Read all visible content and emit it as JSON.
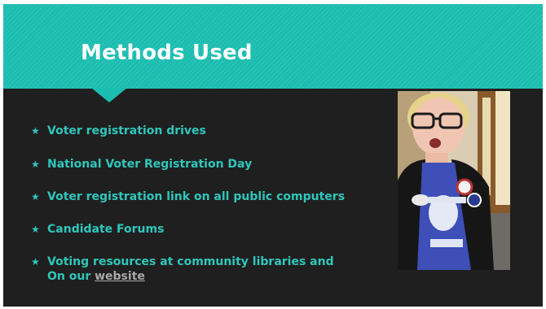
{
  "slide": {
    "title": "Methods Used",
    "bullets": [
      {
        "text": "Voter registration drives"
      },
      {
        "text": "National Voter Registration Day"
      },
      {
        "text": "Voter registration link on all public computers"
      },
      {
        "text": "Candidate Forums"
      },
      {
        "line1": "Voting resources at community libraries and",
        "line2_prefix": "On our ",
        "link_text": "website"
      }
    ],
    "bullet_icon": "star-icon",
    "photo_description_icon": "person-photo"
  },
  "colors": {
    "header": "#1bbdb0",
    "background": "#1f1f1f",
    "bullet_text": "#2ec7bb",
    "link": "#a9a9a9",
    "title": "#ffffff"
  }
}
